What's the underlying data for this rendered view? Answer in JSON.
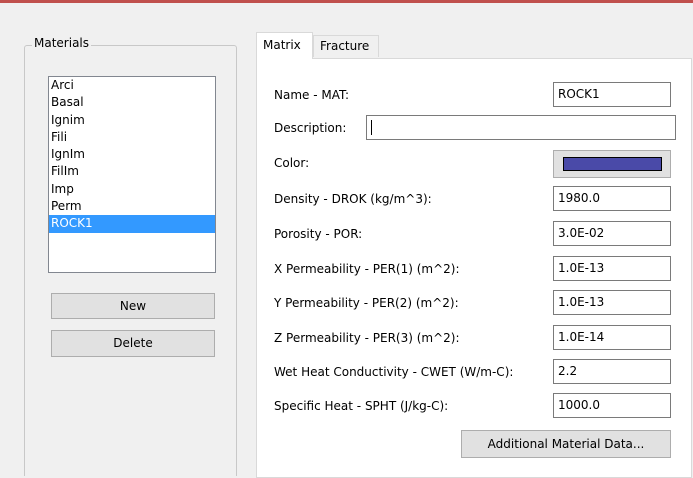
{
  "colors": {
    "accent_bar": "#c0504d",
    "selected": "#3399ff",
    "material_color": "#4a4aa8"
  },
  "materials": {
    "title": "Materials",
    "items": [
      "Arci",
      "Basal",
      "Ignim",
      "Fili",
      "IgnIm",
      "FilIm",
      "Imp",
      "Perm",
      "ROCK1"
    ],
    "selected": "ROCK1",
    "new_label": "New",
    "delete_label": "Delete"
  },
  "tabs": {
    "matrix": "Matrix",
    "fracture": "Fracture",
    "active": "Matrix"
  },
  "form": {
    "name_label": "Name - MAT:",
    "name_value": "ROCK1",
    "description_label": "Description:",
    "description_value": "",
    "color_label": "Color:",
    "density_label": "Density - DROK (kg/m^3):",
    "density_value": "1980.0",
    "porosity_label": "Porosity - POR:",
    "porosity_value": "3.0E-02",
    "xperm_label": "X Permeability - PER(1) (m^2):",
    "xperm_value": "1.0E-13",
    "yperm_label": "Y Permeability - PER(2) (m^2):",
    "yperm_value": "1.0E-13",
    "zperm_label": "Z Permeability - PER(3) (m^2):",
    "zperm_value": "1.0E-14",
    "cwet_label": "Wet Heat Conductivity - CWET (W/m-C):",
    "cwet_value": "2.2",
    "spht_label": "Specific Heat - SPHT (J/kg-C):",
    "spht_value": "1000.0",
    "additional_label": "Additional Material Data..."
  }
}
